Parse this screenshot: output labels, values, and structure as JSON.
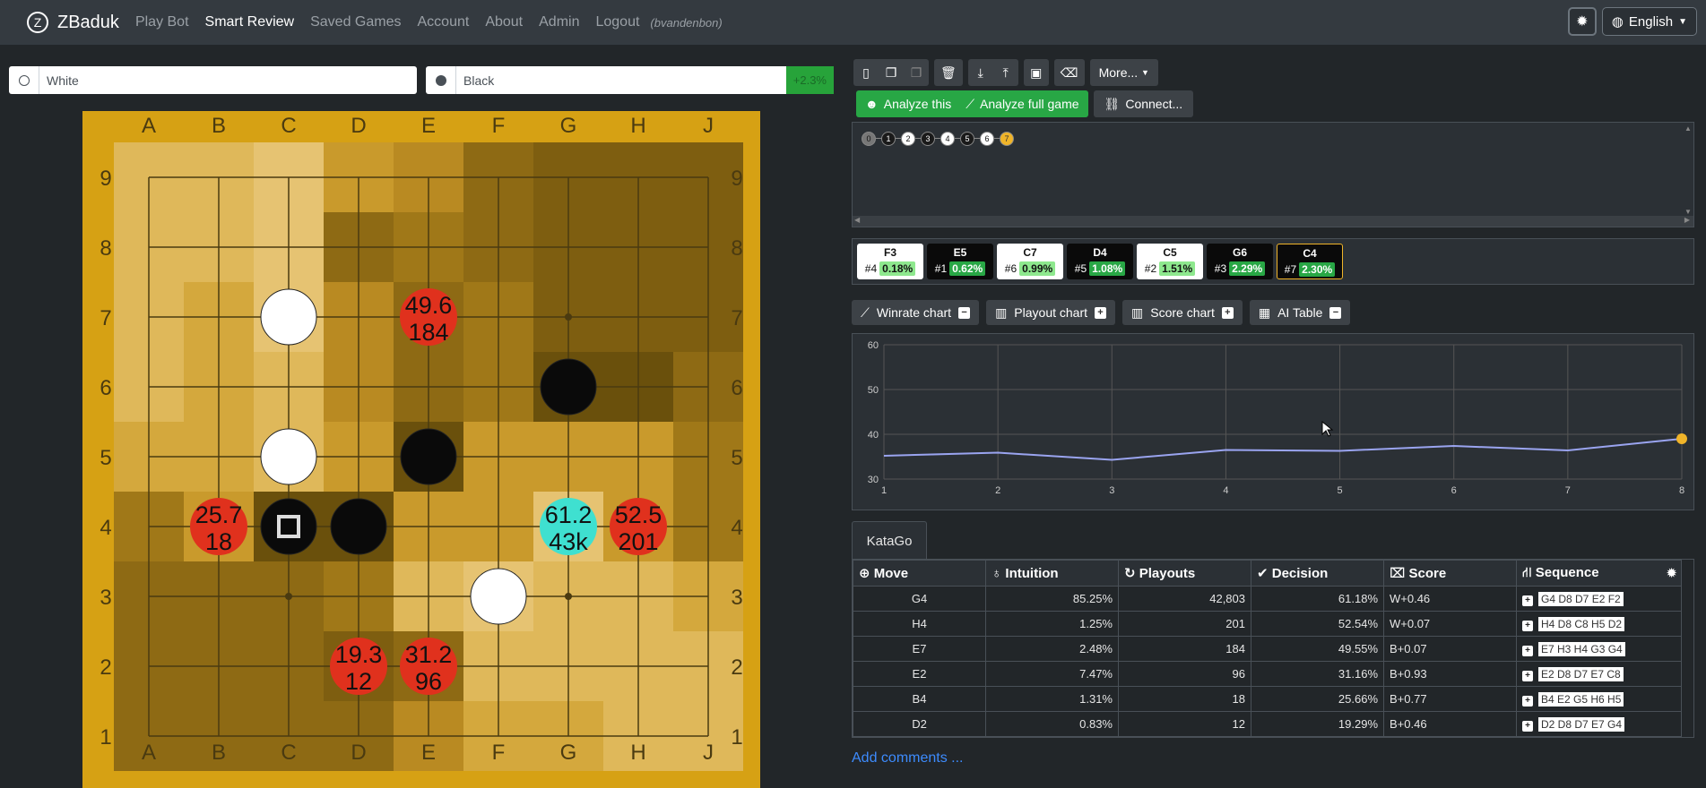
{
  "nav": {
    "brand": "ZBaduk",
    "brand_logo": "Z",
    "links": [
      "Play Bot",
      "Smart Review",
      "Saved Games",
      "Account",
      "About",
      "Admin",
      "Logout"
    ],
    "active": "Smart Review",
    "user": "(bvandenbon)",
    "language": "English",
    "settings_icon": "gear-icon"
  },
  "players": {
    "white": {
      "placeholder": "White"
    },
    "black": {
      "placeholder": "Black",
      "score": "+2.3%"
    }
  },
  "board": {
    "columns": [
      "A",
      "B",
      "C",
      "D",
      "E",
      "F",
      "G",
      "H",
      "J"
    ],
    "rows": [
      "9",
      "8",
      "7",
      "6",
      "5",
      "4",
      "3",
      "2",
      "1"
    ],
    "stones": [
      {
        "color": "white",
        "col": 2,
        "row": 2
      },
      {
        "color": "black",
        "col": 6,
        "row": 3
      },
      {
        "color": "white",
        "col": 2,
        "row": 4
      },
      {
        "color": "black",
        "col": 4,
        "row": 4
      },
      {
        "color": "black",
        "col": 2,
        "row": 5,
        "last": true
      },
      {
        "color": "black",
        "col": 3,
        "row": 5
      },
      {
        "color": "white",
        "col": 5,
        "row": 6
      }
    ],
    "suggestions": [
      {
        "col": 4,
        "row": 2,
        "winrate": "49.6",
        "visits": "184",
        "color": "#e0311d"
      },
      {
        "col": 1,
        "row": 5,
        "winrate": "25.7",
        "visits": "18",
        "color": "#e0311d"
      },
      {
        "col": 6,
        "row": 5,
        "winrate": "61.2",
        "visits": "43k",
        "color": "#3fe0d0"
      },
      {
        "col": 7,
        "row": 5,
        "winrate": "52.5",
        "visits": "201",
        "color": "#e0311d"
      },
      {
        "col": 3,
        "row": 7,
        "winrate": "19.3",
        "visits": "12",
        "color": "#e0311d"
      },
      {
        "col": 4,
        "row": 7,
        "winrate": "31.2",
        "visits": "96",
        "color": "#e0311d"
      }
    ]
  },
  "toolbar": {
    "more": "More...",
    "analyze_this": "Analyze this",
    "analyze_full": "Analyze full game",
    "connect": "Connect..."
  },
  "movetree": {
    "nodes": [
      "0",
      "1",
      "2",
      "3",
      "4",
      "5",
      "6",
      "7"
    ]
  },
  "candidates": [
    {
      "move": "F3",
      "rank": "#4",
      "pct": "0.18%",
      "theme": "white"
    },
    {
      "move": "E5",
      "rank": "#1",
      "pct": "0.62%",
      "theme": "black"
    },
    {
      "move": "C7",
      "rank": "#6",
      "pct": "0.99%",
      "theme": "white"
    },
    {
      "move": "D4",
      "rank": "#5",
      "pct": "1.08%",
      "theme": "black"
    },
    {
      "move": "C5",
      "rank": "#2",
      "pct": "1.51%",
      "theme": "white"
    },
    {
      "move": "G6",
      "rank": "#3",
      "pct": "2.29%",
      "theme": "black"
    },
    {
      "move": "C4",
      "rank": "#7",
      "pct": "2.30%",
      "theme": "black-selected"
    }
  ],
  "chart_tabs": [
    {
      "label": "Winrate chart",
      "toggle": "−"
    },
    {
      "label": "Playout chart",
      "toggle": "+"
    },
    {
      "label": "Score chart",
      "toggle": "+"
    },
    {
      "label": "AI Table",
      "toggle": "−"
    }
  ],
  "chart_data": {
    "type": "line",
    "x": [
      1,
      2,
      3,
      4,
      5,
      6,
      7,
      8
    ],
    "series": [
      {
        "values": [
          35.2,
          35.9,
          34.3,
          36.5,
          36.3,
          37.4,
          36.4,
          39
        ]
      }
    ],
    "ylim": [
      30,
      60
    ],
    "yticks": [
      30,
      40,
      50,
      60
    ],
    "xticks": [
      1,
      2,
      3,
      4,
      5,
      6,
      7,
      8
    ],
    "grid": true,
    "line_color": "#9aa4f0",
    "marker_color": "#f0b429"
  },
  "katago": {
    "tab": "KataGo",
    "headers": [
      "Move",
      "Intuition",
      "Playouts",
      "Decision",
      "Score",
      "Sequence"
    ],
    "rows": [
      {
        "move": "G4",
        "intuition": "85.25%",
        "playouts": "42,803",
        "decision": "61.18%",
        "score": "W+0.46",
        "sequence": "G4 D8 D7 E2 F2"
      },
      {
        "move": "H4",
        "intuition": "1.25%",
        "playouts": "201",
        "decision": "52.54%",
        "score": "W+0.07",
        "sequence": "H4 D8 C8 H5 D2"
      },
      {
        "move": "E7",
        "intuition": "2.48%",
        "playouts": "184",
        "decision": "49.55%",
        "score": "B+0.07",
        "sequence": "E7 H3 H4 G3 G4"
      },
      {
        "move": "E2",
        "intuition": "7.47%",
        "playouts": "96",
        "decision": "31.16%",
        "score": "B+0.93",
        "sequence": "E2 D8 D7 E7 C8"
      },
      {
        "move": "B4",
        "intuition": "1.31%",
        "playouts": "18",
        "decision": "25.66%",
        "score": "B+0.77",
        "sequence": "B4 E2 G5 H6 H5"
      },
      {
        "move": "D2",
        "intuition": "0.83%",
        "playouts": "12",
        "decision": "19.29%",
        "score": "B+0.46",
        "sequence": "D2 D8 D7 E7 G4"
      }
    ]
  },
  "comments_link": "Add comments ..."
}
